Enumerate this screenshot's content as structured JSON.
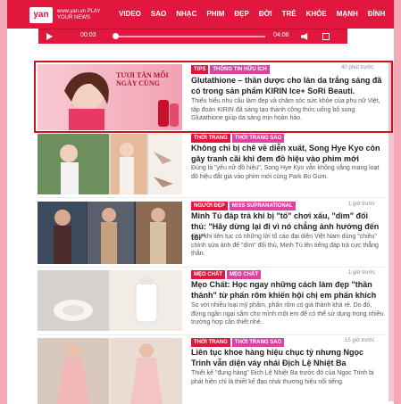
{
  "header": {
    "logo": "yan",
    "logo_sub": "www.yan.vn PLAY YOUR NEWS",
    "nav": [
      "VIDEO",
      "SAO",
      "NHẠC",
      "PHIM",
      "ĐẸP",
      "ĐỜI",
      "TRẺ",
      "KHỎE",
      "MẠNH",
      "ĐỈNH"
    ]
  },
  "player": {
    "current_time": "00:03",
    "duration": "04:08",
    "progress": 0.01
  },
  "articles": [
    {
      "tags": [
        "TIPS",
        "THÔNG TIN HỮU ÍCH"
      ],
      "time": "40 phút trước",
      "title": "Glutathione – thần dược cho làn da trắng sáng đã có trong sản phẩm KIRIN Ice+ SoRi Beauti.",
      "desc": "Thiếu hiểu nhu cầu làm đẹp và chăm sóc sức khỏe của phụ nữ Việt, tập đoàn KIRIN đã sáng tạo thành công thức uống bổ sung Glutathione giúp da sáng mịn hoàn hảo.",
      "thumb_text": "TƯƠI TẮN MỖI NGÀY CÙNG"
    },
    {
      "tags": [
        "THỜI TRANG",
        "THỜI TRANG SAO"
      ],
      "time": "",
      "title": "Không chỉ bị chê về diễn xuất, Song Hye Kyo còn gây tranh cãi khi đem đồ hiệu vào phim mới",
      "desc": "Đúng là \"yêu nữ đồ hiệu\", Song Hye Kyo vẫn không vắng mang loạt đồ hiệu đắt giá vào phim mới cùng Park Bo Gum."
    },
    {
      "tags": [
        "NGƯỜI ĐẸP",
        "MISS SUPRANATIONAL"
      ],
      "time": "1 giờ trước",
      "title": "Minh Tú đáp trả khi bị \"tố\" chơi xấu, \"dìm\" đối thủ: \"Hãy dừng lại đi vì nó chẳng ảnh hưởng đến tôi\"",
      "desc": "Sau khi liên tục có những lời tố cáo đại diện Việt Nam dùng \"chiêu\" chỉnh sửa ảnh để \"dìm\" đối thủ, Minh Tú lên tiếng đáp trả cực thẳng thắn."
    },
    {
      "tags": [
        "MẸO CHẤT",
        "MẸO CHẤT"
      ],
      "time": "1 giờ trước",
      "title": "Mẹo Chất: Học ngay những cách làm đẹp \"thần thánh\" từ phấn rôm khiến hội chị em phấn khích",
      "desc": "So với nhiều loại mỹ phẩm, phấn rôm có giá thành khá rẻ. Do đó, đừng ngần ngại sắm cho mình một em để có thể sử dụng trong nhiều trường hợp cần thiết nhé."
    },
    {
      "tags": [
        "THỜI TRANG",
        "THỜI TRANG SAO"
      ],
      "time": "15 giờ trước",
      "title": "Liên tục khoe hàng hiệu chục tỷ nhưng Ngọc Trinh vẫn diện váy nhái Địch Lệ Nhiệt Ba",
      "desc": "Thiết kế \"đụng hàng\" Địch Lệ Nhiệt Ba trước đó của Ngọc Trinh bị phát hiện chỉ là thiết kế đạo nhái thương hiệu nổi tiếng."
    }
  ],
  "colors": {
    "brand": "#e1173e",
    "tag_pink": "#e040a0",
    "highlight_border": "#d0121f"
  }
}
